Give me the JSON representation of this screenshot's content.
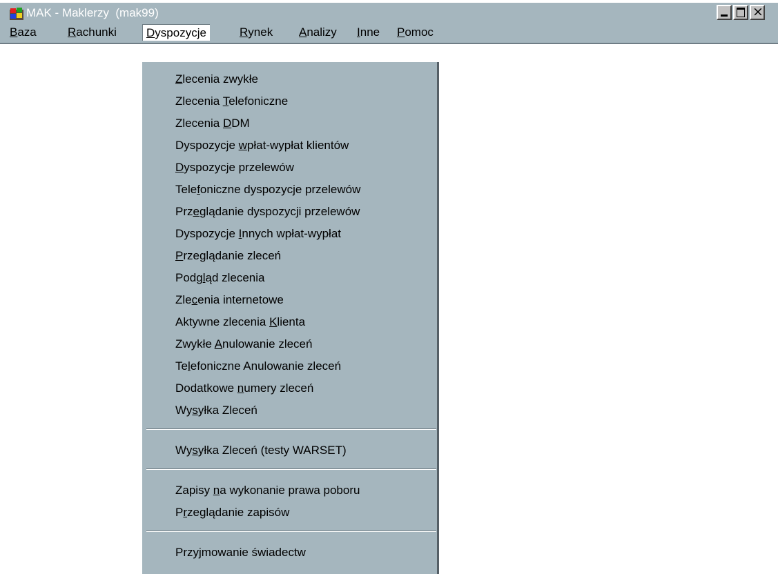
{
  "window": {
    "title": "MAK - Maklerzy  (mak99)",
    "app_icon": "windows-flag-icon",
    "controls": {
      "minimize_icon": "minimize-icon",
      "maximize_icon": "maximize-icon",
      "close_icon": "close-icon",
      "close_glyph": "×"
    }
  },
  "menubar": {
    "items": [
      {
        "pre": "",
        "key": "B",
        "post": "aza"
      },
      {
        "pre": "",
        "key": "R",
        "post": "achunki"
      },
      {
        "pre": "",
        "key": "D",
        "post": "yspozycje"
      },
      {
        "pre": "",
        "key": "R",
        "post": "ynek"
      },
      {
        "pre": "",
        "key": "A",
        "post": "nalizy"
      },
      {
        "pre": "",
        "key": "I",
        "post": "nne"
      },
      {
        "pre": "",
        "key": "P",
        "post": "omoc"
      }
    ],
    "active": "Dyspozycje"
  },
  "dropdown": {
    "items": [
      {
        "pre": "",
        "key": "Z",
        "post": "lecenia zwykłe"
      },
      {
        "pre": "Zlecenia ",
        "key": "T",
        "post": "elefoniczne"
      },
      {
        "pre": "Zlecenia ",
        "key": "D",
        "post": "DM"
      },
      {
        "pre": "Dyspozycje ",
        "key": "w",
        "post": "płat-wypłat klientów"
      },
      {
        "pre": "",
        "key": "D",
        "post": "yspozycje przelewów"
      },
      {
        "pre": "Tele",
        "key": "f",
        "post": "oniczne dyspozycje przelewów"
      },
      {
        "pre": "Prz",
        "key": "e",
        "post": "glądanie dyspozycji przelewów"
      },
      {
        "pre": "Dyspozycje ",
        "key": "I",
        "post": "nnych wpłat-wypłat"
      },
      {
        "pre": "",
        "key": "P",
        "post": "rzeglądanie zleceń"
      },
      {
        "pre": "Podg",
        "key": "l",
        "post": "ąd zlecenia"
      },
      {
        "pre": "Zle",
        "key": "c",
        "post": "enia internetowe"
      },
      {
        "pre": "Aktywne zlecenia ",
        "key": "K",
        "post": "lienta"
      },
      {
        "pre": "Zwykłe ",
        "key": "A",
        "post": "nulowanie zleceń"
      },
      {
        "pre": "Te",
        "key": "l",
        "post": "efoniczne Anulowanie zleceń"
      },
      {
        "pre": "Dodatkowe ",
        "key": "n",
        "post": "umery zleceń"
      },
      {
        "pre": "Wy",
        "key": "s",
        "post": "yłka Zleceń"
      },
      {
        "pre": "Wy",
        "key": "s",
        "post": "yłka Zleceń (testy WARSET)"
      },
      {
        "pre": "Zapisy ",
        "key": "n",
        "post": "a wykonanie prawa poboru"
      },
      {
        "pre": "P",
        "key": "r",
        "post": "zeglądanie zapisów"
      },
      {
        "pre": "Przyjmowanie świadectw",
        "key": "",
        "post": ""
      }
    ]
  }
}
